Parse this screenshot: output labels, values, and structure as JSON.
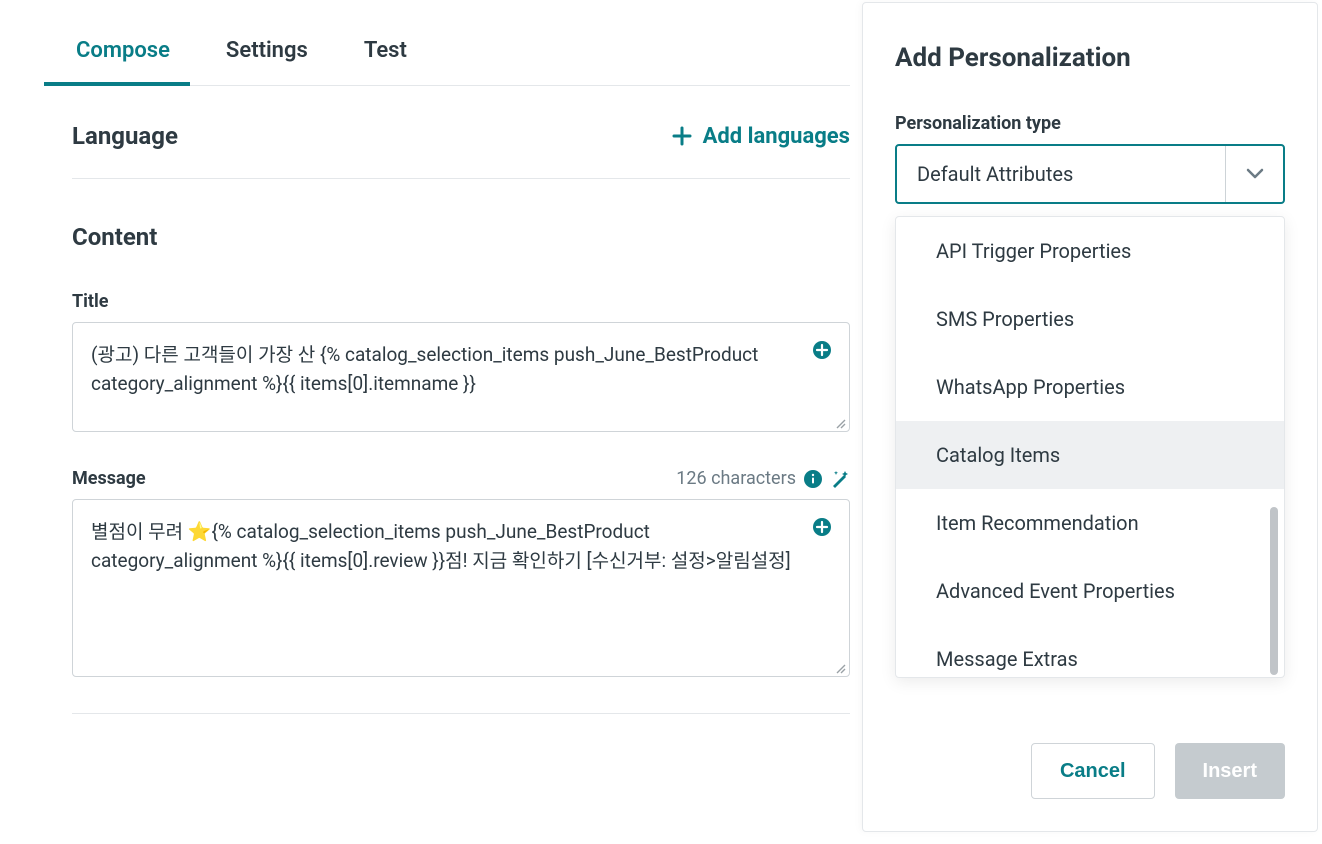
{
  "tabs": [
    {
      "label": "Compose",
      "active": true
    },
    {
      "label": "Settings",
      "active": false
    },
    {
      "label": "Test",
      "active": false
    }
  ],
  "language_section": {
    "title": "Language",
    "add_button": "Add languages"
  },
  "content_section": {
    "title": "Content",
    "title_field": {
      "label": "Title",
      "value": "(광고) 다른 고객들이 가장 산 {% catalog_selection_items push_June_BestProduct category_alignment %}{{ items[0].itemname }}"
    },
    "message_field": {
      "label": "Message",
      "char_count": "126 characters",
      "value": "별점이 무려 ⭐{% catalog_selection_items push_June_BestProduct category_alignment %}{{ items[0].review }}점! 지금 확인하기 [수신거부: 설정>알림설정]"
    }
  },
  "side_panel": {
    "title": "Add Personalization",
    "field_label": "Personalization type",
    "selected": "Default Attributes",
    "options": [
      {
        "label": "API Trigger Properties",
        "highlight": false
      },
      {
        "label": "SMS Properties",
        "highlight": false
      },
      {
        "label": "WhatsApp Properties",
        "highlight": false
      },
      {
        "label": "Catalog Items",
        "highlight": true
      },
      {
        "label": "Item Recommendation",
        "highlight": false
      },
      {
        "label": "Advanced Event Properties",
        "highlight": false
      },
      {
        "label": "Message Extras",
        "highlight": false
      }
    ],
    "cancel": "Cancel",
    "insert": "Insert"
  }
}
